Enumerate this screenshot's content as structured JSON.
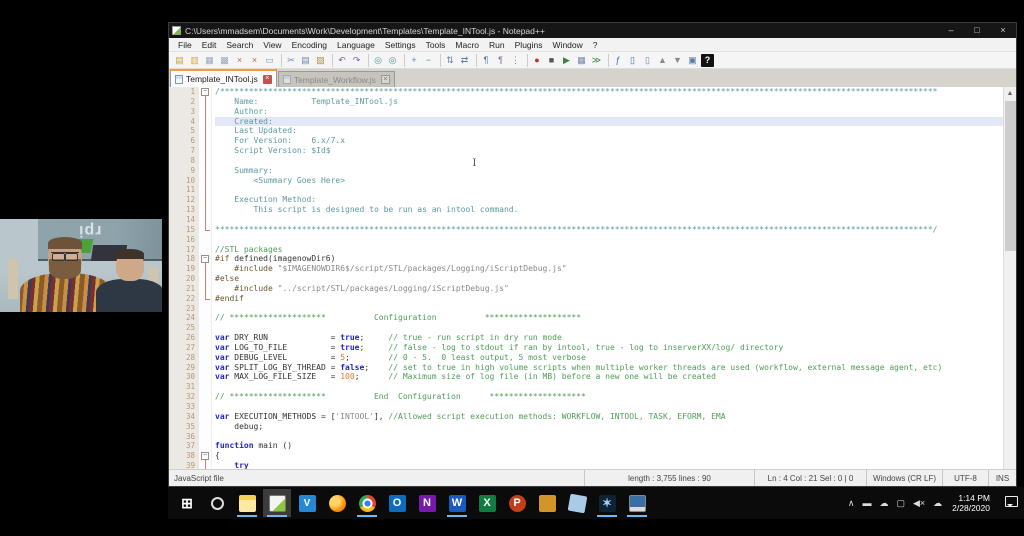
{
  "window": {
    "title": "C:\\Users\\mmadsem\\Documents\\Work\\Development\\Templates\\Template_INTool.js - Notepad++",
    "controls": {
      "minimize": "–",
      "maximize": "□",
      "close": "×"
    }
  },
  "menu": {
    "items": [
      "File",
      "Edit",
      "Search",
      "View",
      "Encoding",
      "Language",
      "Settings",
      "Tools",
      "Macro",
      "Run",
      "Plugins",
      "Window",
      "?"
    ]
  },
  "toolbar": {
    "icons": [
      {
        "name": "new-file-icon",
        "g": "▤",
        "fg": "#caa23f"
      },
      {
        "name": "open-file-icon",
        "g": "▥",
        "fg": "#d8a940"
      },
      {
        "name": "save-icon",
        "g": "▦",
        "fg": "#9aa7b8"
      },
      {
        "name": "save-all-icon",
        "g": "▩",
        "fg": "#9aa7b8"
      },
      {
        "name": "close-file-icon",
        "g": "×",
        "fg": "#b07050"
      },
      {
        "name": "close-all-icon",
        "g": "×",
        "fg": "#b07050"
      },
      {
        "name": "print-icon",
        "g": "▭",
        "fg": "#6f9f9f"
      },
      {
        "name": "cut-icon",
        "g": "✂",
        "fg": "#6f87b0",
        "sep": true
      },
      {
        "name": "copy-icon",
        "g": "▤",
        "fg": "#6f87b0"
      },
      {
        "name": "paste-icon",
        "g": "▧",
        "fg": "#b08f4a"
      },
      {
        "name": "undo-icon",
        "g": "↶",
        "fg": "#7d5fb0",
        "sep": true
      },
      {
        "name": "redo-icon",
        "g": "↷",
        "fg": "#7d5fb0"
      },
      {
        "name": "find-icon",
        "g": "◎",
        "fg": "#4f8f9f",
        "sep": true
      },
      {
        "name": "replace-icon",
        "g": "◎",
        "fg": "#4f8f9f"
      },
      {
        "name": "zoom-in-icon",
        "g": "+",
        "fg": "#4f8f9f",
        "sep": true
      },
      {
        "name": "zoom-out-icon",
        "g": "−",
        "fg": "#4f8f9f"
      },
      {
        "name": "sync-vertical-icon",
        "g": "⇅",
        "fg": "#5a7ba5",
        "sep": true
      },
      {
        "name": "sync-horizontal-icon",
        "g": "⇄",
        "fg": "#5a7ba5"
      },
      {
        "name": "word-wrap-icon",
        "g": "¶",
        "fg": "#46789a",
        "sep": true
      },
      {
        "name": "show-all-chars-icon",
        "g": "¶",
        "fg": "#8f6fae"
      },
      {
        "name": "indent-guide-icon",
        "g": "⋮",
        "fg": "#888888"
      },
      {
        "name": "record-macro-icon",
        "g": "●",
        "fg": "#c23030",
        "sep": true
      },
      {
        "name": "stop-macro-icon",
        "g": "■",
        "fg": "#555555"
      },
      {
        "name": "play-macro-icon",
        "g": "▶",
        "fg": "#3f7f3f"
      },
      {
        "name": "save-macro-icon",
        "g": "▦",
        "fg": "#6f87b0"
      },
      {
        "name": "run-macro-multiple-icon",
        "g": "≫",
        "fg": "#3f7f3f"
      },
      {
        "name": "function-list-icon",
        "g": "ƒ",
        "fg": "#3f6faf",
        "sep": true
      },
      {
        "name": "doc-map-icon",
        "g": "▯",
        "fg": "#3f6faf"
      },
      {
        "name": "doc-switcher-icon",
        "g": "▯",
        "fg": "#6f87b0"
      },
      {
        "name": "fold-all-icon",
        "g": "▲",
        "fg": "#8a8a8a"
      },
      {
        "name": "unfold-all-icon",
        "g": "▼",
        "fg": "#8a8a8a"
      },
      {
        "name": "monitoring-icon",
        "g": "▣",
        "fg": "#5a7ba5"
      },
      {
        "name": "help-icon",
        "g": "?",
        "fg": "#ffffff",
        "boxed": true
      }
    ]
  },
  "tabs": [
    {
      "label": "Template_INTool.js",
      "active": true
    },
    {
      "label": "Template_Workflow.js",
      "active": false
    }
  ],
  "editor": {
    "current_line": 4,
    "folds": [
      {
        "start": 1,
        "end": 15
      },
      {
        "start": 18,
        "end": 22
      },
      {
        "start": 38,
        "end": 39,
        "open_ended": true
      }
    ],
    "lines": [
      [
        [
          "bc",
          "/*****************************************************************************************************************************************************"
        ]
      ],
      [
        [
          "bc",
          "    Name:           Template_INTool.js"
        ]
      ],
      [
        [
          "bc",
          "    Author:"
        ]
      ],
      [
        [
          "bc",
          "    Created:"
        ]
      ],
      [
        [
          "bc",
          "    Last Updated:"
        ]
      ],
      [
        [
          "bc",
          "    For Version:    6.x/7.x"
        ]
      ],
      [
        [
          "bc",
          "    Script Version: $Id$"
        ]
      ],
      [
        [
          "bc",
          ""
        ]
      ],
      [
        [
          "bc",
          "    Summary:"
        ]
      ],
      [
        [
          "bc",
          "        <Summary Goes Here>"
        ]
      ],
      [
        [
          "bc",
          ""
        ]
      ],
      [
        [
          "bc",
          "    Execution Method:"
        ]
      ],
      [
        [
          "bc",
          "        This script is designed to be run as an intool command."
        ]
      ],
      [
        [
          "bc",
          ""
        ]
      ],
      [
        [
          "bc",
          "*****************************************************************************************************************************************************/"
        ]
      ],
      [
        [
          "tx",
          ""
        ]
      ],
      [
        [
          "lc",
          "//STL packages"
        ]
      ],
      [
        [
          "pp",
          "#if"
        ],
        [
          "tx",
          " defined(imagenowDir6)"
        ]
      ],
      [
        [
          "tx",
          "    "
        ],
        [
          "pp",
          "#include "
        ],
        [
          "str",
          "\"$IMAGENOWDIR6$/script/STL/packages/Logging/iScriptDebug.js\""
        ]
      ],
      [
        [
          "pp",
          "#else"
        ]
      ],
      [
        [
          "tx",
          "    "
        ],
        [
          "pp",
          "#include "
        ],
        [
          "str",
          "\"../script/STL/packages/Logging/iScriptDebug.js\""
        ]
      ],
      [
        [
          "pp",
          "#endif"
        ]
      ],
      [
        [
          "tx",
          ""
        ]
      ],
      [
        [
          "lc",
          "// ********************          Configuration          ********************"
        ]
      ],
      [
        [
          "tx",
          ""
        ]
      ],
      [
        [
          "kw",
          "var"
        ],
        [
          "tx",
          " DRY_RUN             = "
        ],
        [
          "kw",
          "true"
        ],
        [
          "tx",
          ";     "
        ],
        [
          "lc",
          "// true - run script in dry run mode"
        ]
      ],
      [
        [
          "kw",
          "var"
        ],
        [
          "tx",
          " LOG_TO_FILE         = "
        ],
        [
          "kw",
          "true"
        ],
        [
          "tx",
          ";     "
        ],
        [
          "lc",
          "// false - log to stdout if ran by intool, true - log to inserverXX/log/ directory"
        ]
      ],
      [
        [
          "kw",
          "var"
        ],
        [
          "tx",
          " DEBUG_LEVEL         = "
        ],
        [
          "num",
          "5"
        ],
        [
          "tx",
          ";        "
        ],
        [
          "lc",
          "// 0 - 5.  0 least output, 5 most verbose"
        ]
      ],
      [
        [
          "kw",
          "var"
        ],
        [
          "tx",
          " SPLIT_LOG_BY_THREAD = "
        ],
        [
          "kw",
          "false"
        ],
        [
          "tx",
          ";    "
        ],
        [
          "lc",
          "// set to true in high volume scripts when multiple worker threads are used (workflow, external message agent, etc)"
        ]
      ],
      [
        [
          "kw",
          "var"
        ],
        [
          "tx",
          " MAX_LOG_FILE_SIZE   = "
        ],
        [
          "num",
          "100"
        ],
        [
          "tx",
          ";      "
        ],
        [
          "lc",
          "// Maximum size of log file (in MB) before a new one will be created"
        ]
      ],
      [
        [
          "tx",
          ""
        ]
      ],
      [
        [
          "lc",
          "// ********************          End  Configuration      ********************"
        ]
      ],
      [
        [
          "tx",
          ""
        ]
      ],
      [
        [
          "kw",
          "var"
        ],
        [
          "tx",
          " EXECUTION_METHODS = ["
        ],
        [
          "str",
          "'INTOOL'"
        ],
        [
          "tx",
          "], "
        ],
        [
          "lc",
          "//Allowed script execution methods: WORKFLOW, INTOOL, TASK, EFORM, EMA"
        ]
      ],
      [
        [
          "tx",
          "    debug;"
        ]
      ],
      [
        [
          "tx",
          ""
        ]
      ],
      [
        [
          "kw",
          "function"
        ],
        [
          "tx",
          " main ()"
        ]
      ],
      [
        [
          "tx",
          "{"
        ]
      ],
      [
        [
          "tx",
          "    "
        ],
        [
          "kw",
          "try"
        ]
      ]
    ]
  },
  "statusbar": {
    "doctype": "JavaScript file",
    "length_lines": "length : 3,755    lines : 90",
    "position": "Ln : 4    Col : 21    Sel : 0 | 0",
    "eol": "Windows (CR LF)",
    "encoding": "UTF-8",
    "mode": "INS"
  },
  "taskbar": {
    "items": [
      {
        "name": "start-button",
        "cls": "ti-start",
        "g": "⊞",
        "running": false,
        "active": false
      },
      {
        "name": "search-button",
        "cls": "ti-search",
        "g": "",
        "running": false,
        "active": false
      },
      {
        "name": "file-explorer-icon",
        "cls": "ti-explorer",
        "g": "",
        "running": true,
        "active": false
      },
      {
        "name": "notepad-plus-plus-icon",
        "cls": "ti-npp",
        "g": "",
        "running": true,
        "active": true
      },
      {
        "name": "vscode-icon",
        "cls": "ti-vscode",
        "g": "V",
        "running": false,
        "active": false
      },
      {
        "name": "firefox-icon",
        "cls": "ti-firefox",
        "g": "",
        "running": false,
        "active": false
      },
      {
        "name": "chrome-icon",
        "cls": "ti-chrome",
        "g": "",
        "running": true,
        "active": false
      },
      {
        "name": "outlook-icon",
        "cls": "ti-outlook",
        "g": "O",
        "running": false,
        "active": false
      },
      {
        "name": "onenote-icon",
        "cls": "ti-onenote",
        "g": "N",
        "running": false,
        "active": false
      },
      {
        "name": "word-icon",
        "cls": "ti-word",
        "g": "W",
        "running": true,
        "active": false
      },
      {
        "name": "excel-icon",
        "cls": "ti-excel",
        "g": "X",
        "running": false,
        "active": false
      },
      {
        "name": "powerpoint-icon",
        "cls": "ti-powerpoint",
        "g": "P",
        "running": false,
        "active": false
      },
      {
        "name": "app-gold-icon",
        "cls": "ti-gold",
        "g": "",
        "running": false,
        "active": false
      },
      {
        "name": "app-blue-icon",
        "cls": "ti-blue3d",
        "g": "",
        "running": false,
        "active": false
      },
      {
        "name": "snowflake-app-icon",
        "cls": "ti-snowflake",
        "g": "✶",
        "running": true,
        "active": false
      },
      {
        "name": "remote-desktop-icon",
        "cls": "ti-vm",
        "g": "",
        "running": true,
        "active": false
      }
    ],
    "tray": [
      {
        "name": "tray-chevron-icon",
        "g": "∧"
      },
      {
        "name": "battery-icon",
        "g": "▬"
      },
      {
        "name": "cloud-icon",
        "g": "☁"
      },
      {
        "name": "display-icon",
        "g": "▢"
      },
      {
        "name": "volume-muted-icon",
        "g": "◀×"
      },
      {
        "name": "onedrive-icon",
        "g": "☁"
      }
    ],
    "clock": {
      "time": "1:14 PM",
      "date": "2/28/2020"
    }
  },
  "webcam": {
    "sign_text": "rpi"
  }
}
